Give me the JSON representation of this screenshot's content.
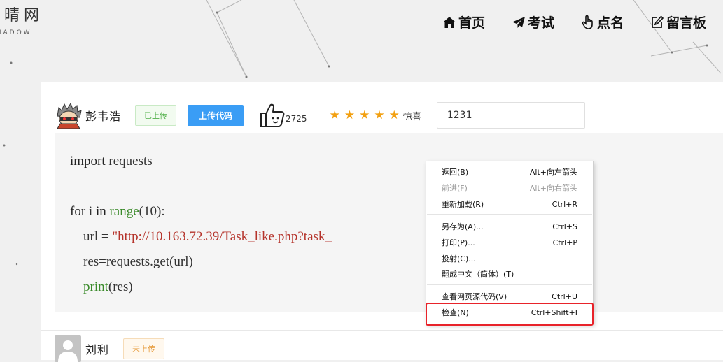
{
  "logo": {
    "main": "心晴网",
    "sub": "SHADOW"
  },
  "nav": [
    {
      "label": "首页",
      "icon": "home-icon"
    },
    {
      "label": "考试",
      "icon": "paper-plane-icon"
    },
    {
      "label": "点名",
      "icon": "hand-pointer-icon"
    },
    {
      "label": "留言板",
      "icon": "edit-icon"
    }
  ],
  "entries": [
    {
      "name": "彭韦浩",
      "status": "已上传",
      "upload_button": "上传代码",
      "likes": "2725",
      "stars": 5,
      "stars_label": "惊喜",
      "score": "1231"
    },
    {
      "name": "刘利",
      "status": "未上传"
    }
  ],
  "code": {
    "line1_kw": "import",
    "line1_rest": " requests",
    "line3_kw1": "for",
    "line3_var": " i ",
    "line3_kw2": "in",
    "line3_fn": " range",
    "line3_args": "(10):",
    "line4_pre": "    url = ",
    "line4_str": "\"http://10.163.72.39/Task_like.php?task_",
    "line5": "    res=requests.get(url)",
    "line6_fn": "    print",
    "line6_args": "(res)"
  },
  "context_menu": [
    {
      "label": "返回(B)",
      "shortcut": "Alt+向左箭头",
      "disabled": false
    },
    {
      "label": "前进(F)",
      "shortcut": "Alt+向右箭头",
      "disabled": true
    },
    {
      "label": "重新加载(R)",
      "shortcut": "Ctrl+R",
      "disabled": false
    },
    {
      "label": "另存为(A)...",
      "shortcut": "Ctrl+S",
      "disabled": false
    },
    {
      "label": "打印(P)...",
      "shortcut": "Ctrl+P",
      "disabled": false
    },
    {
      "label": "投射(C)...",
      "shortcut": "",
      "disabled": false
    },
    {
      "label": "翻成中文（简体）(T)",
      "shortcut": "",
      "disabled": false
    },
    {
      "label": "查看网页源代码(V)",
      "shortcut": "Ctrl+U",
      "disabled": false
    },
    {
      "label": "检查(N)",
      "shortcut": "Ctrl+Shift+I",
      "disabled": false
    }
  ],
  "colors": {
    "highlight": "#e8232a",
    "upload_button": "#3a9df5",
    "star": "#f2a011",
    "uploaded_badge": "#52b04a",
    "not_uploaded_badge": "#e69a3a"
  }
}
